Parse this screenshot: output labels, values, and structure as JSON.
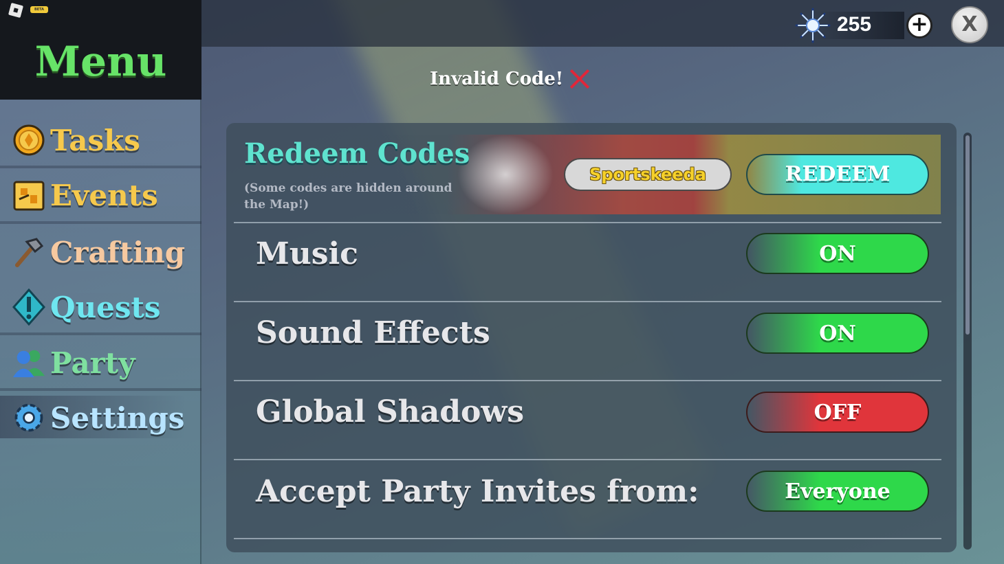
{
  "sidebar": {
    "title": "Menu",
    "beta_label": "BETA",
    "items": [
      {
        "label": "Tasks",
        "color": "#f6c94c"
      },
      {
        "label": "Events",
        "color": "#f6c94c"
      },
      {
        "label": "Crafting",
        "color": "#f6c9a0"
      },
      {
        "label": "Quests",
        "color": "#6fe6f0"
      },
      {
        "label": "Party",
        "color": "#7fe0a0"
      },
      {
        "label": "Settings",
        "color": "#b8e4ff"
      }
    ]
  },
  "topbar": {
    "currency_value": "255",
    "plus_label": "+",
    "close_label": "X"
  },
  "status": {
    "message": "Invalid Code!"
  },
  "redeem": {
    "title": "Redeem Codes",
    "subtitle": "(Some codes are hidden around the Map!)",
    "code_value": "Sportskeeda",
    "button_label": "REDEEM"
  },
  "settings": [
    {
      "label": "Music",
      "value": "ON"
    },
    {
      "label": "Sound Effects",
      "value": "ON"
    },
    {
      "label": "Global Shadows",
      "value": "OFF"
    },
    {
      "label": "Accept Party Invites from:",
      "value": "Everyone"
    }
  ],
  "colors": {
    "menu_title": "#67e368",
    "redeem_title": "#5fe3cf",
    "toggle_on": "#2ed84a",
    "toggle_off": "#e0353b",
    "redeem_button": "#4ee8e0",
    "invalid_x": "#e0273a"
  }
}
